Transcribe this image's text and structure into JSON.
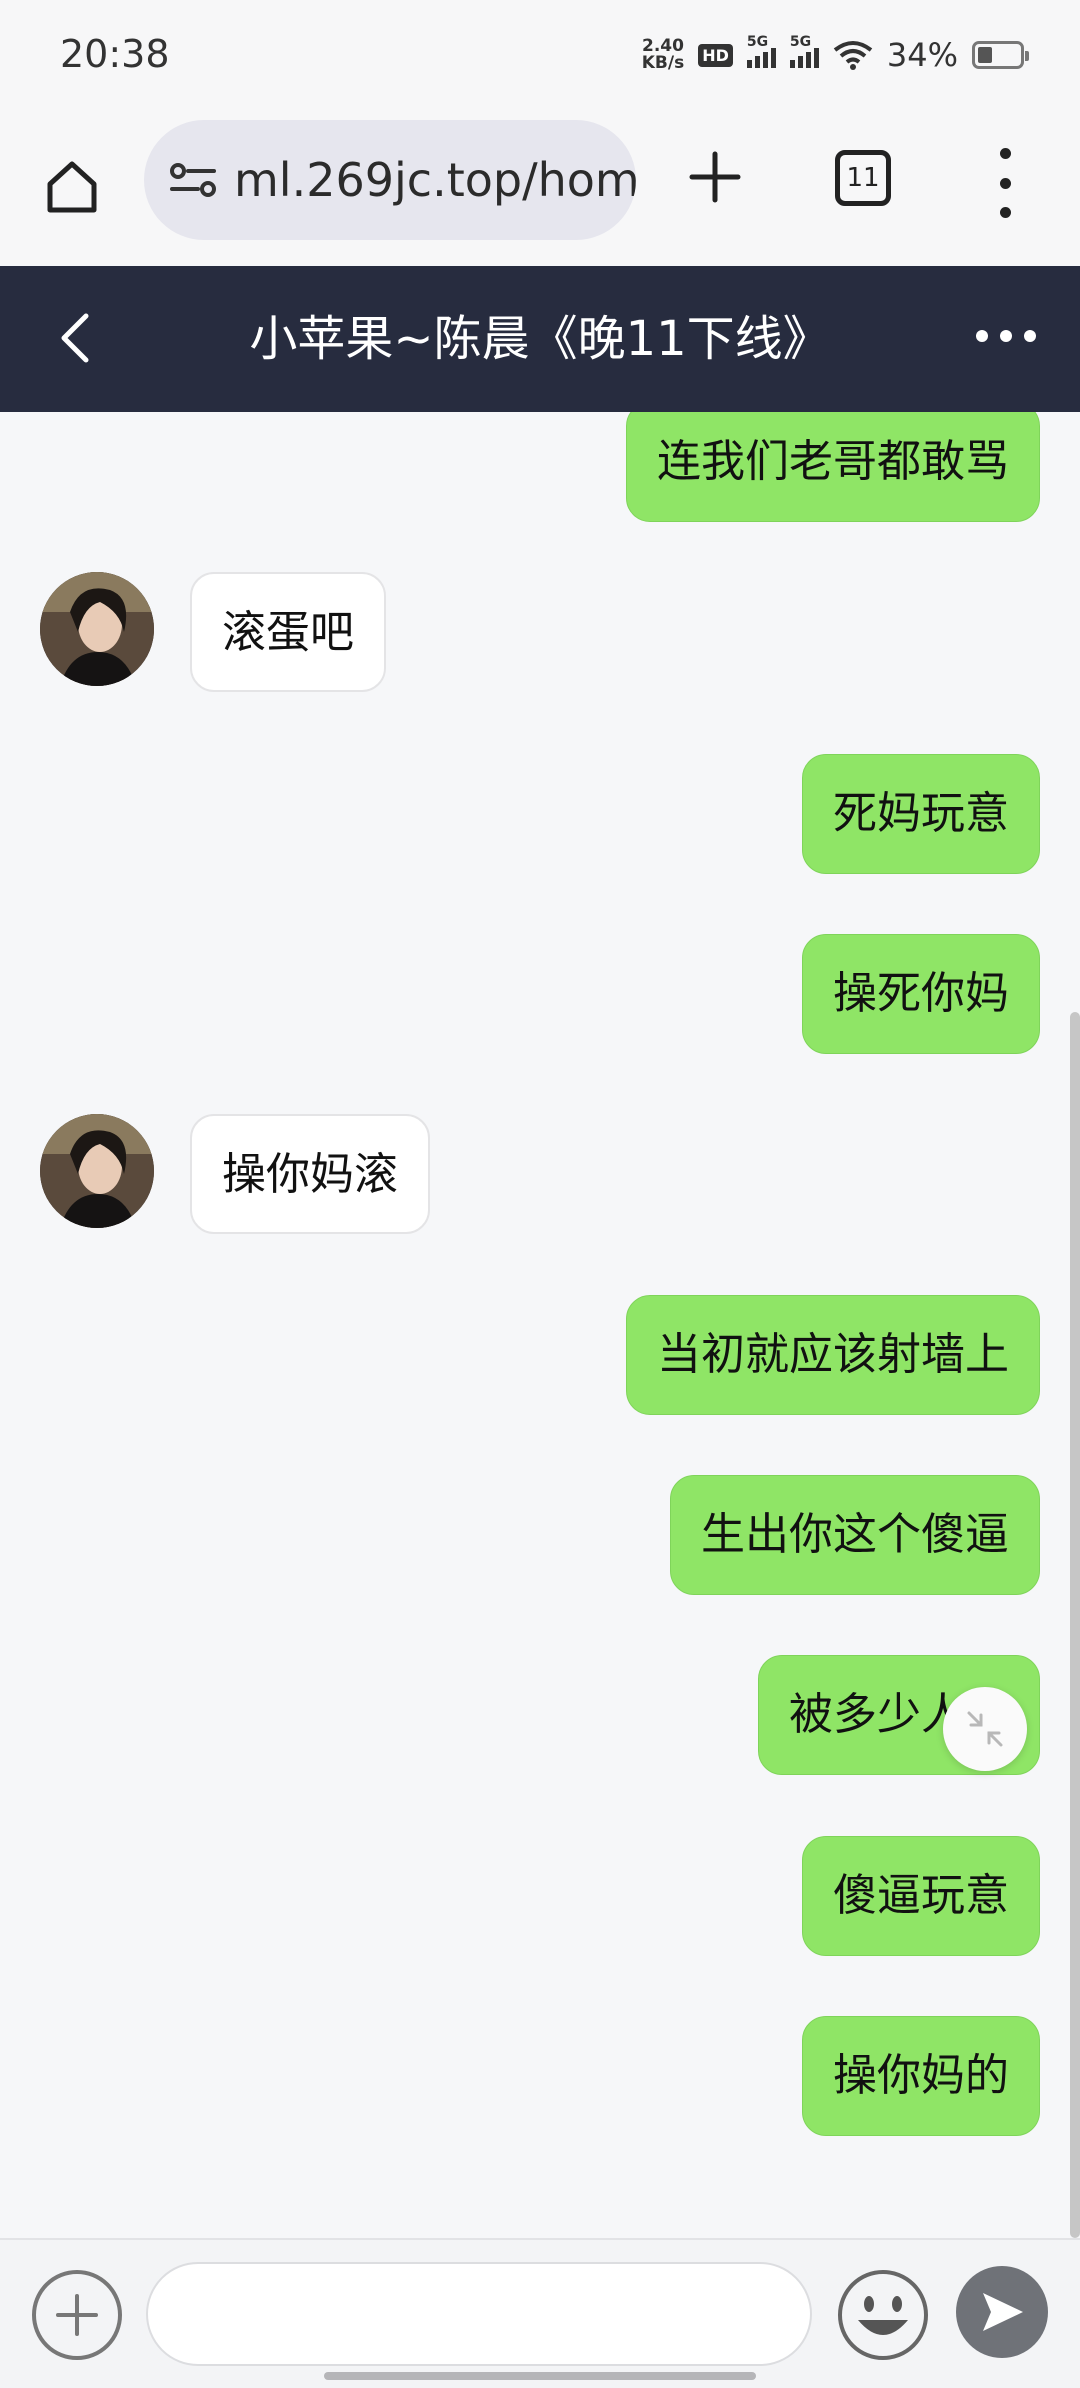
{
  "status_bar": {
    "time": "20:38",
    "net_speed_value": "2.40",
    "net_speed_unit": "KB/s",
    "hd": "HD",
    "signal1": "5G",
    "signal2": "5G",
    "battery_percent": "34%"
  },
  "browser": {
    "url": "ml.269jc.top/hom",
    "tab_count": "11"
  },
  "chat": {
    "title": "小苹果~陈晨《晚11下线》",
    "messages": [
      {
        "side": "me",
        "text": "连我们老哥都敢骂"
      },
      {
        "side": "them",
        "text": "滚蛋吧"
      },
      {
        "side": "me",
        "text": "死妈玩意"
      },
      {
        "side": "me",
        "text": "操死你妈"
      },
      {
        "side": "them",
        "text": "操你妈滚"
      },
      {
        "side": "me",
        "text": "当初就应该射墙上"
      },
      {
        "side": "me",
        "text": "生出你这个傻逼"
      },
      {
        "side": "me",
        "text": "被多少人骂"
      },
      {
        "side": "me",
        "text": "傻逼玩意"
      },
      {
        "side": "me",
        "text": "操你妈的"
      }
    ]
  },
  "input": {
    "placeholder": ""
  },
  "colors": {
    "header_bg": "#272c3f",
    "my_bubble": "#8fe566",
    "their_bubble": "#ffffff",
    "chat_bg": "#f6f7f9"
  }
}
